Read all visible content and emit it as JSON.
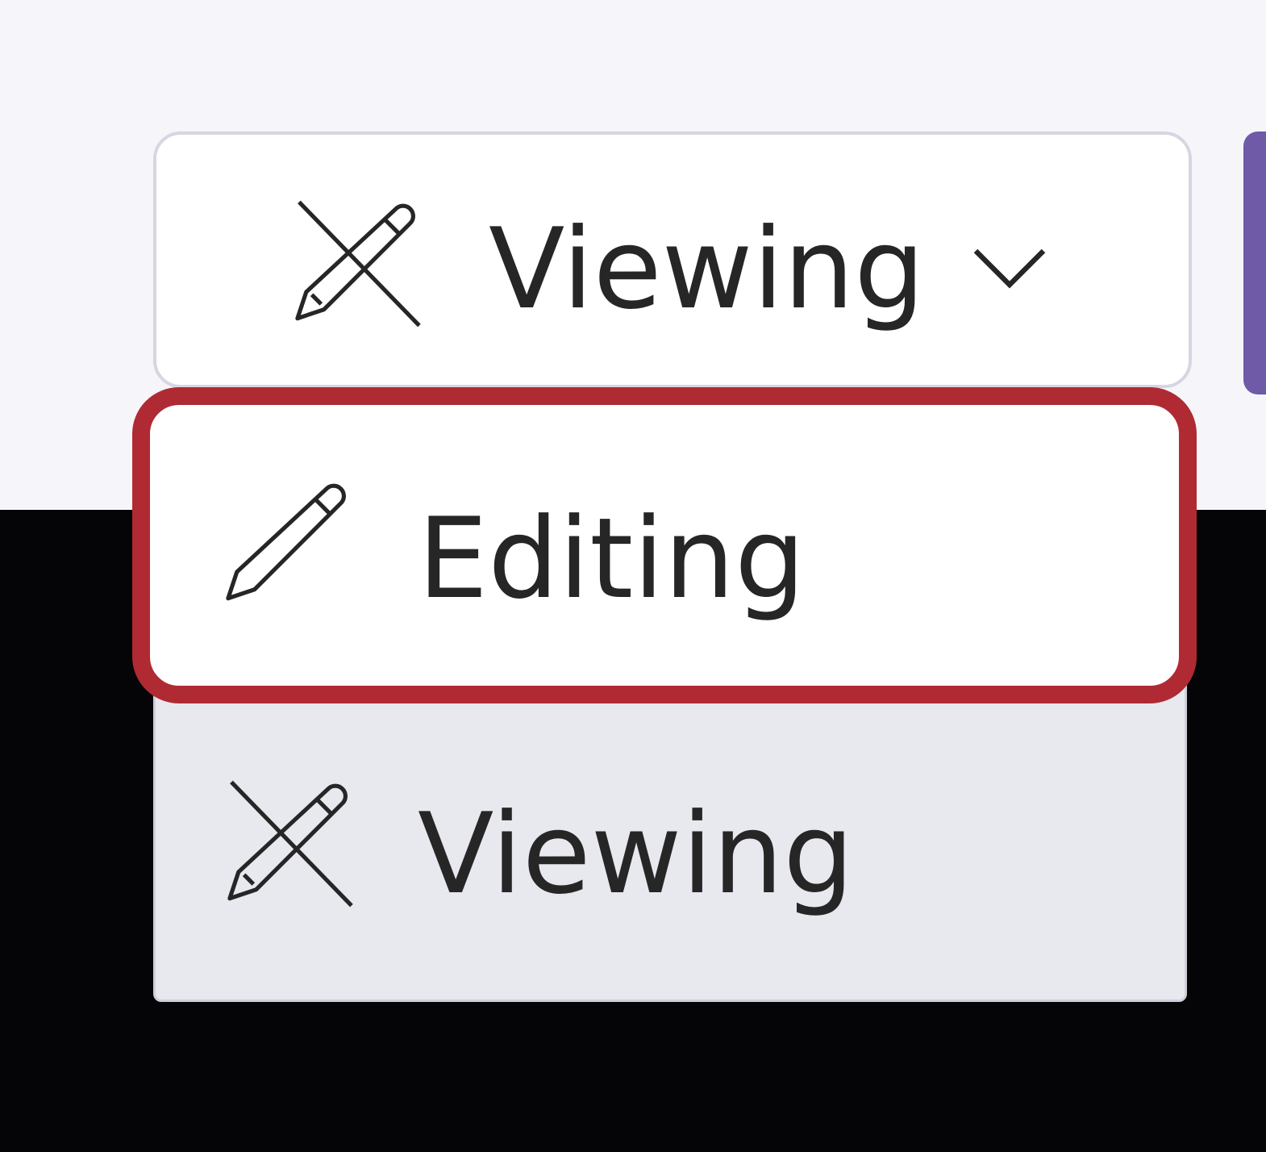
{
  "mode_switcher": {
    "current_mode_label": "Viewing",
    "current_mode_icon": "pencil-off-icon",
    "expand_icon": "chevron-down-icon"
  },
  "mode_menu": {
    "items": [
      {
        "label": "Editing",
        "icon": "pencil-icon",
        "state": "highlighted"
      },
      {
        "label": "Viewing",
        "icon": "pencil-off-icon",
        "state": "selected"
      }
    ]
  },
  "colors": {
    "toolbar_background": "#f5f5fa",
    "highlight_outline": "#b02a33",
    "selected_item_background": "#e8e8ef",
    "primary_accent": "#6e5aa6",
    "text": "#262626"
  }
}
